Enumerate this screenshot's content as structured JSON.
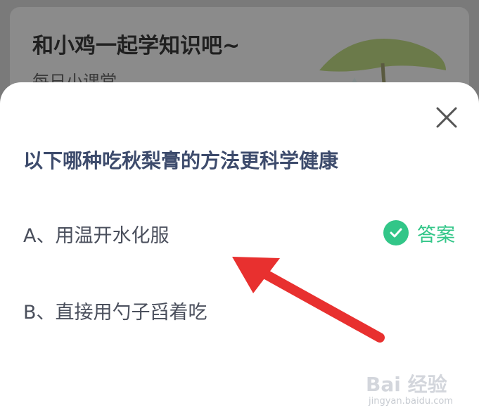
{
  "background": {
    "title": "和小鸡一起学知识吧~",
    "subtitle": "每日小课堂",
    "illustration_icon": "chick-under-leaf-icon"
  },
  "dialog": {
    "close_icon": "close-icon",
    "question": "以下哪种吃秋梨膏的方法更科学健康",
    "options": [
      {
        "label": "A、用温开水化服",
        "is_answer": true,
        "answer_label": "答案",
        "answer_icon": "check-circle-icon"
      },
      {
        "label": "B、直接用勺子舀着吃",
        "is_answer": false
      }
    ]
  },
  "overlay": {
    "arrow_icon": "red-pointer-arrow-icon",
    "arrow_color": "#e8302f"
  },
  "watermark": {
    "main": "Bai 经验",
    "sub": "jingyan.baidu.com"
  },
  "colors": {
    "accent_green": "#32c688",
    "question_text": "#3d4b6c",
    "option_text": "#4a4f5c"
  }
}
